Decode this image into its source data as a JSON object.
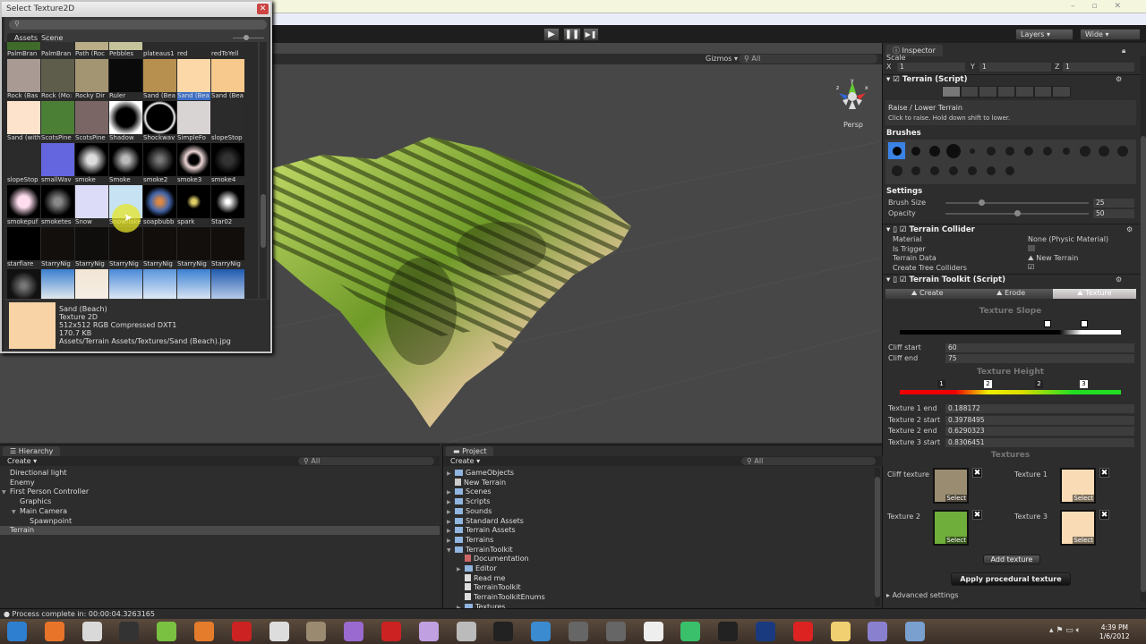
{
  "picker": {
    "title": "Select Texture2D",
    "search_value": "",
    "tabs": [
      "Assets",
      "Scene"
    ],
    "active_tab": "Assets",
    "rows": [
      [
        {
          "label": "PalmBran",
          "color": "#3f6a2a"
        },
        {
          "label": "PalmBran",
          "color": "#2f2f2f"
        },
        {
          "label": "Path (Roc",
          "color": "#b9ad88"
        },
        {
          "label": "Pebbles",
          "color": "#c4c39b"
        },
        {
          "label": "plateaus1",
          "color": "#2b2b2b"
        },
        {
          "label": "red",
          "color": "#2b2b2b"
        },
        {
          "label": "redToYell",
          "color": "#2b2b2b"
        }
      ],
      [
        {
          "label": "Rock (Bas",
          "color": "#a99a94"
        },
        {
          "label": "Rock (Mo:",
          "color": "#5e5d4c"
        },
        {
          "label": "Rocky Dir",
          "color": "#a49572"
        },
        {
          "label": "Ruler",
          "color": "#0a0a0a"
        },
        {
          "label": "Sand (Bea",
          "color": "#b78f4e"
        },
        {
          "label": "Sand (Bea",
          "color": "#fcd8a8",
          "selected": true
        },
        {
          "label": "Sand (Bea",
          "color": "#f7c98c"
        }
      ],
      [
        {
          "label": "Sand (with",
          "color": "#fde3cc"
        },
        {
          "label": "ScotsPine",
          "color": "#4c7f36"
        },
        {
          "label": "ScotsPine",
          "color": "#7a6664"
        },
        {
          "label": "Shadow",
          "color": "radial-gradient(#000 40%,#fff 75%)"
        },
        {
          "label": "Shockwav",
          "color": "radial-gradient(#000 55%,#fff 62%,#000 72%)"
        },
        {
          "label": "SimpleFo",
          "color": "#d9d4d4"
        },
        {
          "label": "slopeStop",
          "color": "#2b2b2b"
        }
      ],
      [
        {
          "label": "slopeStop",
          "color": "#2b2b2b"
        },
        {
          "label": "smallWav",
          "color": "#6466e0"
        },
        {
          "label": "smoke",
          "color": "radial-gradient(#ddd 20%,#000 65%)"
        },
        {
          "label": "Smoke",
          "color": "radial-gradient(#bbb 15%,#000 60%)"
        },
        {
          "label": "smoke2",
          "color": "radial-gradient(#777 10%,#000 60%)"
        },
        {
          "label": "smoke3",
          "color": "radial-gradient(#000 20%,#f0d8d8 35%,#000 65%)"
        },
        {
          "label": "smoke4",
          "color": "radial-gradient(#333 20%,#000 60%)"
        }
      ],
      [
        {
          "label": "smokepuf",
          "color": "radial-gradient(#fde 25%,#000 65%)"
        },
        {
          "label": "smoketes",
          "color": "radial-gradient(#888 15%,#000 60%)"
        },
        {
          "label": "Snow",
          "color": "#dcdcf8"
        },
        {
          "label": "Snowflake",
          "color": "#c7e2f2"
        },
        {
          "label": "soapbubb",
          "color": "radial-gradient(#d84 10%,#46a 40%,#000 65%)"
        },
        {
          "label": "spark",
          "color": "radial-gradient(#dc6 10%,#000 30%)"
        },
        {
          "label": "Star02",
          "color": "radial-gradient(#fff 8%,#000 50%)"
        }
      ],
      [
        {
          "label": "starflare",
          "color": "#000"
        },
        {
          "label": "StarryNig",
          "color": "#120f0c"
        },
        {
          "label": "StarryNig",
          "color": "#100e0c"
        },
        {
          "label": "StarryNig",
          "color": "#120f0c"
        },
        {
          "label": "StarryNig",
          "color": "#110e0c"
        },
        {
          "label": "StarryNig",
          "color": "#120f0c"
        },
        {
          "label": "StarryNig",
          "color": "#110e0c"
        }
      ],
      [
        {
          "label": "",
          "color": "radial-gradient(#777 10%,#111 60%)"
        },
        {
          "label": "",
          "color": "linear-gradient(#3a7fd0,#f5f5f0)"
        },
        {
          "label": "",
          "color": "linear-gradient(#f2e6d5,#f6efe6)"
        },
        {
          "label": "",
          "color": "linear-gradient(#4a8ad8,#eef2f8)"
        },
        {
          "label": "",
          "color": "linear-gradient(#5a95dc,#f0f4fa)"
        },
        {
          "label": "",
          "color": "linear-gradient(#3a80d2,#eaf0f8)"
        },
        {
          "label": "",
          "color": "linear-gradient(#1f5ab0,#c8d8ee)"
        }
      ]
    ],
    "info": {
      "name": "Sand (Beach)",
      "type": "Texture 2D",
      "format": "512x512  RGB Compressed DXT1",
      "size": "170.7 KB",
      "path": "Assets/Terrain Assets/Textures/Sand (Beach).jpg",
      "color": "#f7d3a6"
    }
  },
  "toolbar": {
    "play": "▶",
    "pause": "❚❚",
    "step": "▶❚",
    "layers": "Layers",
    "layout": "Wide"
  },
  "scene": {
    "gizmos": "Gizmos ▾",
    "search": "All",
    "persp": "Persp",
    "axes": {
      "y": "y",
      "x": "x",
      "z": "z"
    }
  },
  "inspector": {
    "tab": "Inspector",
    "scale_label": "Scale",
    "scale": {
      "x_label": "X",
      "x": "1",
      "y_label": "Y",
      "y": "1",
      "z_label": "Z",
      "z": "1"
    },
    "terrain_script": {
      "title": "Terrain (Script)",
      "tool_title": "Raise / Lower Terrain",
      "tool_hint": "Click to raise. Hold down shift to lower.",
      "brushes_label": "Brushes",
      "settings_label": "Settings",
      "brush_size_label": "Brush Size",
      "brush_size": "25",
      "brush_size_frac": 0.25,
      "opacity_label": "Opacity",
      "opacity": "50",
      "opacity_frac": 0.5
    },
    "collider": {
      "title": "Terrain Collider",
      "material_label": "Material",
      "material": "None (Physic Material)",
      "trigger_label": "Is Trigger",
      "is_trigger": false,
      "data_label": "Terrain Data",
      "data": "New Terrain",
      "trees_label": "Create Tree Colliders",
      "create_trees": true
    },
    "toolkit": {
      "title": "Terrain Toolkit (Script)",
      "tabs": [
        "Create",
        "Erode",
        "Texture"
      ],
      "active_tab": "Texture",
      "slope_title": "Texture Slope",
      "cliff_start_label": "Cliff start",
      "cliff_start": "60",
      "cliff_end_label": "Cliff end",
      "cliff_end": "75",
      "height_title": "Texture Height",
      "markers": [
        "1",
        "2",
        "2",
        "3"
      ],
      "heights": [
        {
          "label": "Texture 1 end",
          "value": "0.188172"
        },
        {
          "label": "Texture 2 start",
          "value": "0.3978495"
        },
        {
          "label": "Texture 2 end",
          "value": "0.6290323"
        },
        {
          "label": "Texture 3 start",
          "value": "0.8306451"
        }
      ],
      "textures_title": "Textures",
      "textures": [
        {
          "label": "Cliff texture",
          "color": "#9a8c70"
        },
        {
          "label": "Texture 1",
          "color": "#f9dcb5"
        },
        {
          "label": "Texture 2",
          "color": "#6fae3a"
        },
        {
          "label": "Texture 3",
          "color": "#f9dcb5"
        }
      ],
      "select_label": "Select",
      "remove_label": "✖",
      "add_texture": "Add texture",
      "apply": "Apply procedural texture",
      "advanced": "Advanced settings"
    }
  },
  "hierarchy": {
    "tab": "Hierarchy",
    "create": "Create ▾",
    "search": "All",
    "items": [
      {
        "label": "Directional light",
        "depth": 0,
        "arrow": ""
      },
      {
        "label": "Enemy",
        "depth": 0,
        "arrow": ""
      },
      {
        "label": "First Person Controller",
        "depth": 0,
        "arrow": "▼"
      },
      {
        "label": "Graphics",
        "depth": 1,
        "arrow": ""
      },
      {
        "label": "Main Camera",
        "depth": 1,
        "arrow": "▼"
      },
      {
        "label": "Spawnpoint",
        "depth": 2,
        "arrow": ""
      },
      {
        "label": "Terrain",
        "depth": 0,
        "arrow": "",
        "selected": true
      }
    ]
  },
  "project": {
    "tab": "Project",
    "create": "Create ▾",
    "search": "All",
    "items": [
      {
        "label": "GameObjects",
        "depth": 0,
        "arrow": "▶",
        "kind": "folder"
      },
      {
        "label": "New Terrain",
        "depth": 0,
        "arrow": "",
        "kind": "terrain"
      },
      {
        "label": "Scenes",
        "depth": 0,
        "arrow": "▶",
        "kind": "folder"
      },
      {
        "label": "Scripts",
        "depth": 0,
        "arrow": "▶",
        "kind": "folder"
      },
      {
        "label": "Sounds",
        "depth": 0,
        "arrow": "▶",
        "kind": "folder"
      },
      {
        "label": "Standard Assets",
        "depth": 0,
        "arrow": "▶",
        "kind": "folder"
      },
      {
        "label": "Terrain Assets",
        "depth": 0,
        "arrow": "▶",
        "kind": "folder"
      },
      {
        "label": "Terrains",
        "depth": 0,
        "arrow": "▶",
        "kind": "folder"
      },
      {
        "label": "TerrainToolkit",
        "depth": 0,
        "arrow": "▼",
        "kind": "folder"
      },
      {
        "label": "Documentation",
        "depth": 1,
        "arrow": "",
        "kind": "doc"
      },
      {
        "label": "Editor",
        "depth": 1,
        "arrow": "▶",
        "kind": "folder"
      },
      {
        "label": "Read me",
        "depth": 1,
        "arrow": "",
        "kind": "file"
      },
      {
        "label": "TerrainToolkit",
        "depth": 1,
        "arrow": "",
        "kind": "file"
      },
      {
        "label": "TerrainToolkitEnums",
        "depth": 1,
        "arrow": "",
        "kind": "file"
      },
      {
        "label": "Textures",
        "depth": 1,
        "arrow": "▶",
        "kind": "folder"
      }
    ]
  },
  "status": "Process complete in: 00:00:04.3263165",
  "taskbar": {
    "apps": [
      {
        "name": "start",
        "color": "#2f7fd0"
      },
      {
        "name": "firefox",
        "color": "#e8742a"
      },
      {
        "name": "chrome",
        "color": "#d9d9d9"
      },
      {
        "name": "app",
        "color": "#333"
      },
      {
        "name": "spotify",
        "color": "#7ac142"
      },
      {
        "name": "audacity",
        "color": "#e57c2c"
      },
      {
        "name": "app2",
        "color": "#c22"
      },
      {
        "name": "app3",
        "color": "#ddd"
      },
      {
        "name": "soundbooth",
        "color": "#9a8a70"
      },
      {
        "name": "premiere",
        "color": "#9a6ad0"
      },
      {
        "name": "acrobat",
        "color": "#c22"
      },
      {
        "name": "app4",
        "color": "#c0a0e0"
      },
      {
        "name": "app5",
        "color": "#bbb"
      },
      {
        "name": "app6",
        "color": "#222"
      },
      {
        "name": "cinema",
        "color": "#3a8bd0"
      },
      {
        "name": "app7",
        "color": "#666"
      },
      {
        "name": "app8",
        "color": "#666"
      },
      {
        "name": "unity",
        "color": "#eee"
      },
      {
        "name": "sims",
        "color": "#3ac06a"
      },
      {
        "name": "steam",
        "color": "#222"
      },
      {
        "name": "league",
        "color": "#1a3a80"
      },
      {
        "name": "acrobat2",
        "color": "#d22"
      },
      {
        "name": "explorer",
        "color": "#f0d070"
      },
      {
        "name": "app9",
        "color": "#8a80d0"
      },
      {
        "name": "app10",
        "color": "#7aa0d0"
      }
    ],
    "time": "4:39 PM",
    "date": "1/6/2012"
  }
}
